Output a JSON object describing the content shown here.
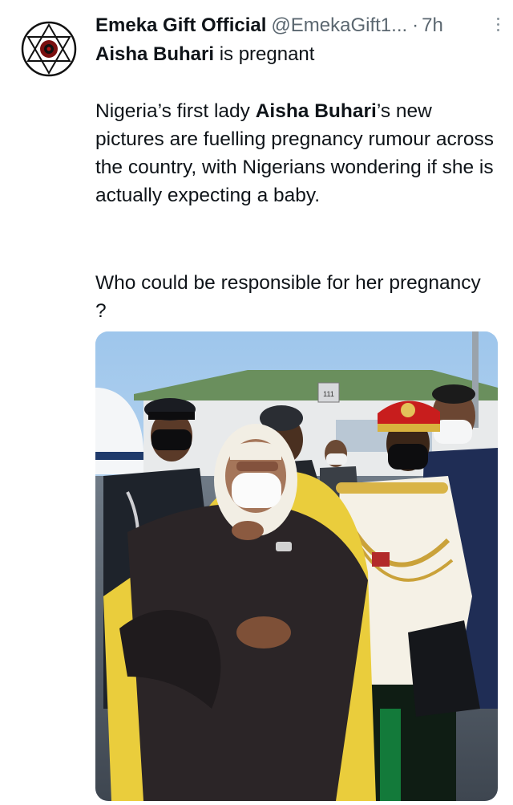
{
  "author": {
    "name": "Emeka Gift Official",
    "handle": "@EmekaGift1...",
    "separator": "·",
    "time": "7h"
  },
  "headline": {
    "bold": "Aisha Buhari",
    "rest": " is pregnant"
  },
  "body": {
    "part1": "Nigeria’s first lady ",
    "bold": "Aisha Buhari",
    "part2": "’s new pictures are fuelling pregnancy rumour across the country, with Nigerians wondering if she is actually expecting a baby."
  },
  "question": "Who could be responsible for her pregnancy ?",
  "photo": {
    "building_sign": "111"
  },
  "icons": {
    "avatar": "hexagram-logo-icon",
    "more": "more-vertical-icon"
  },
  "colors": {
    "text": "#0f1419",
    "secondary": "#5b6770"
  }
}
